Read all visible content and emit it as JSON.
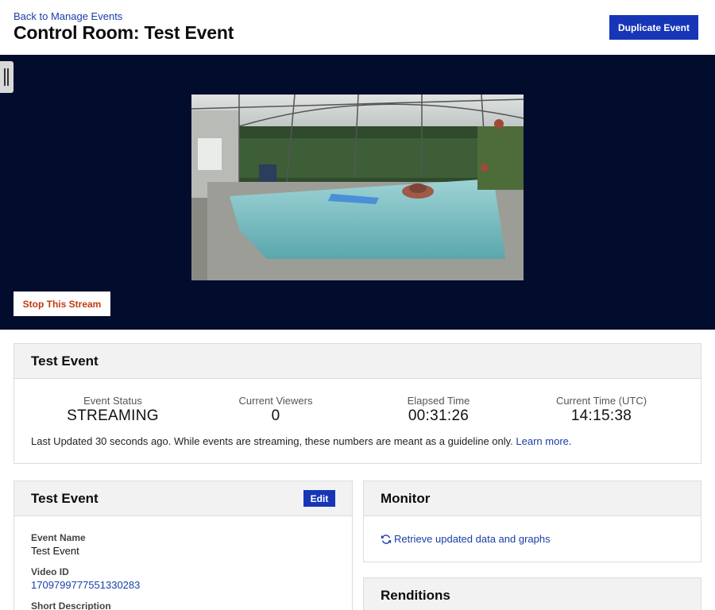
{
  "header": {
    "back_link": "Back to Manage Events",
    "title": "Control Room: Test Event",
    "duplicate_button": "Duplicate Event"
  },
  "stream": {
    "stop_button": "Stop This Stream"
  },
  "status_card": {
    "title": "Test Event",
    "stats": [
      {
        "label": "Event Status",
        "value": "STREAMING"
      },
      {
        "label": "Current Viewers",
        "value": "0"
      },
      {
        "label": "Elapsed Time",
        "value": "00:31:26"
      },
      {
        "label": "Current Time (UTC)",
        "value": "14:15:38"
      }
    ],
    "note": "Last Updated 30 seconds ago. While events are streaming, these numbers are meant as a guideline only.",
    "learn_more": "Learn more",
    "note_end": "."
  },
  "details_card": {
    "title": "Test Event",
    "edit_button": "Edit",
    "fields": [
      {
        "label": "Event Name",
        "value": "Test Event"
      },
      {
        "label": "Video ID",
        "value": "1709799777551330283"
      },
      {
        "label": "Short Description",
        "value": ""
      }
    ]
  },
  "monitor_card": {
    "title": "Monitor",
    "link": "Retrieve updated data and graphs"
  },
  "renditions_card": {
    "title": "Renditions"
  },
  "colors": {
    "primary": "#1636b7",
    "video_bg": "#020c2d",
    "stop_text": "#c23b10",
    "link": "#1a3ea8"
  }
}
